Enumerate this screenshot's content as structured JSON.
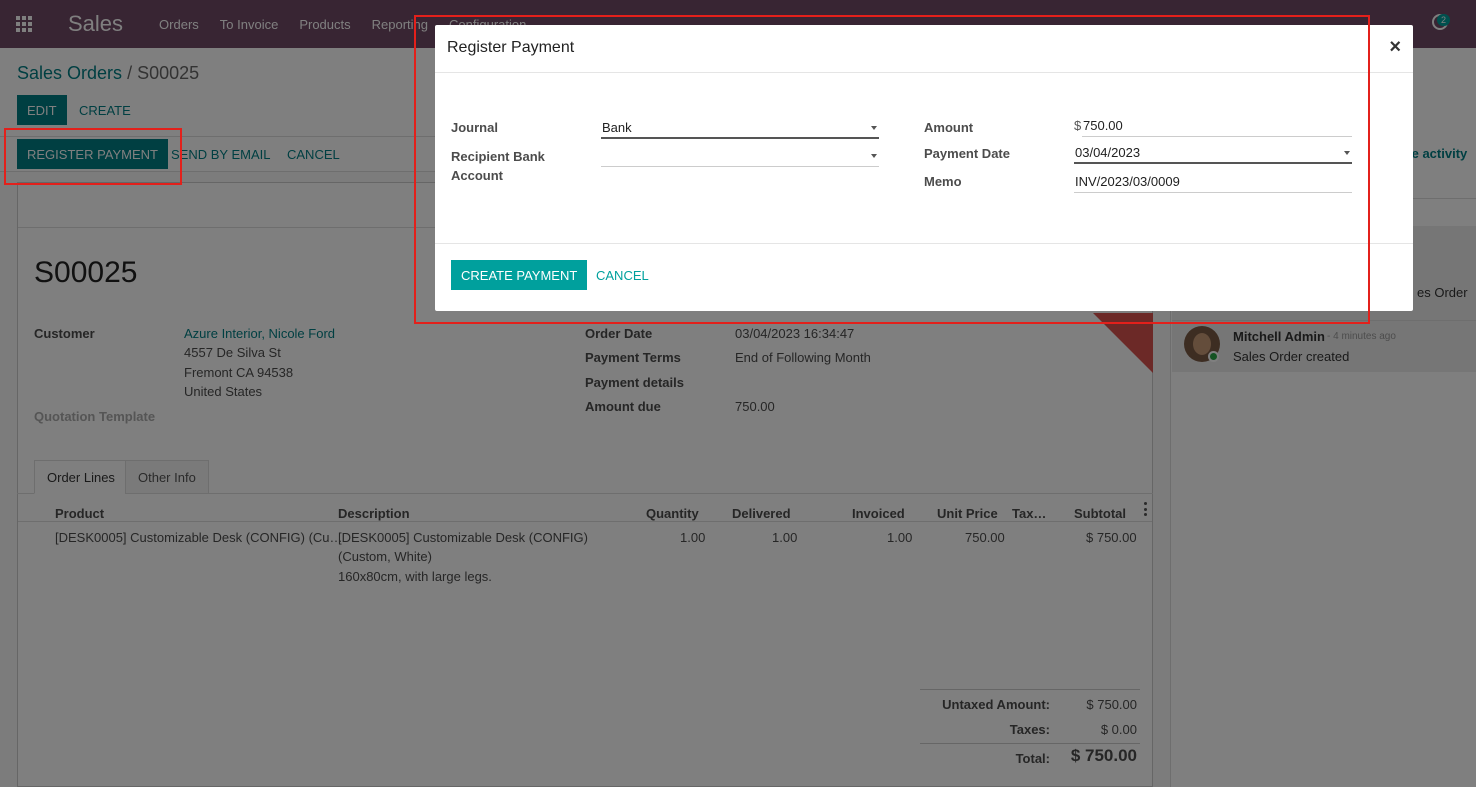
{
  "navbar": {
    "brand": "Sales",
    "menu": [
      "Orders",
      "To Invoice",
      "Products",
      "Reporting",
      "Configuration"
    ],
    "badge": "2"
  },
  "breadcrumb": {
    "parent": "Sales Orders",
    "separator": "/",
    "current": "S00025"
  },
  "actions": {
    "edit": "EDIT",
    "create": "CREATE"
  },
  "statusbar": {
    "register_payment": "REGISTER PAYMENT",
    "send_by_email": "SEND BY EMAIL",
    "cancel": "CANCEL"
  },
  "form": {
    "name": "S00025",
    "customer_label": "Customer",
    "customer_name": "Azure Interior, Nicole Ford",
    "address": [
      "4557 De Silva St",
      "Fremont CA 94538",
      "United States"
    ],
    "quotation_template_label": "Quotation Template",
    "order_date_label": "Order Date",
    "order_date": "03/04/2023 16:34:47",
    "payment_terms_label": "Payment Terms",
    "payment_terms": "End of Following Month",
    "payment_details_label": "Payment details",
    "amount_due_label": "Amount due",
    "amount_due": "750.00"
  },
  "tabs": [
    "Order Lines",
    "Other Info"
  ],
  "table": {
    "headers": [
      "Product",
      "Description",
      "Quantity",
      "Delivered",
      "Invoiced",
      "Unit Price",
      "Tax…",
      "Subtotal"
    ],
    "rows": [
      {
        "product": "[DESK0005] Customizable Desk (CONFIG) (Cu…",
        "description": [
          "[DESK0005] Customizable Desk (CONFIG)",
          "(Custom, White)",
          "160x80cm, with large legs."
        ],
        "quantity": "1.00",
        "delivered": "1.00",
        "invoiced": "1.00",
        "unit_price": "750.00",
        "subtotal": "$ 750.00"
      }
    ]
  },
  "totals": {
    "untaxed_label": "Untaxed Amount:",
    "untaxed": "$ 750.00",
    "taxes_label": "Taxes:",
    "taxes": "$ 0.00",
    "total_label": "Total:",
    "total": "$ 750.00"
  },
  "chatter": {
    "schedule_activity_partial": "le activity",
    "msg1_partial": "es Order",
    "author": "Mitchell Admin",
    "time": "- 4 minutes ago",
    "body": "Sales Order created"
  },
  "dialog": {
    "title": "Register Payment",
    "close": "×",
    "journal_label": "Journal",
    "journal_value": "Bank",
    "recipient_label_1": "Recipient Bank",
    "recipient_label_2": "Account",
    "recipient_value": "",
    "amount_label": "Amount",
    "amount_currency": "$",
    "amount_value": "750.00",
    "payment_date_label": "Payment Date",
    "payment_date_value": "03/04/2023",
    "memo_label": "Memo",
    "memo_value": "INV/2023/03/0009",
    "create_payment": "CREATE PAYMENT",
    "cancel": "CANCEL"
  },
  "colors": {
    "navbar": "#714B67",
    "primary": "#017e84",
    "dialog_primary": "#00A09D",
    "annotation": "#e3201b"
  }
}
